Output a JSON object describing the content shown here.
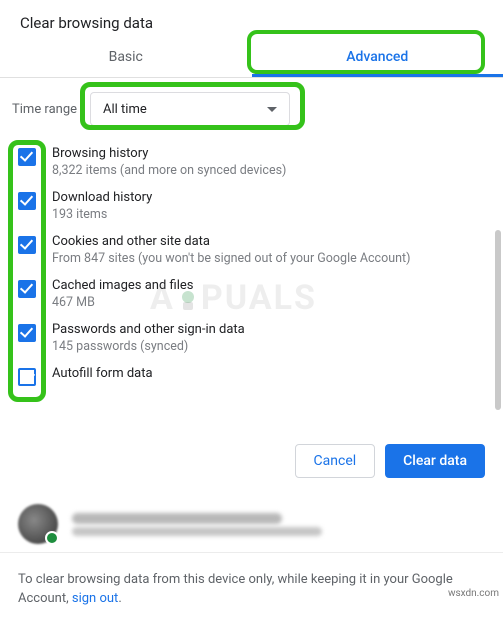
{
  "dialog": {
    "title": "Clear browsing data"
  },
  "tabs": {
    "basic": "Basic",
    "advanced": "Advanced"
  },
  "time": {
    "label": "Time range",
    "value": "All time"
  },
  "items": [
    {
      "title": "Browsing history",
      "sub": "8,322 items (and more on synced devices)"
    },
    {
      "title": "Download history",
      "sub": "193 items"
    },
    {
      "title": "Cookies and other site data",
      "sub": "From 847 sites (you won't be signed out of your Google Account)"
    },
    {
      "title": "Cached images and files",
      "sub": "467 MB"
    },
    {
      "title": "Passwords and other sign-in data",
      "sub": "145 passwords (synced)"
    },
    {
      "title": "Autofill form data",
      "sub": ""
    }
  ],
  "buttons": {
    "cancel": "Cancel",
    "clear": "Clear data"
  },
  "footer": {
    "text_a": "To clear browsing data from this device only, while keeping it in your Google Account, ",
    "signout": "sign out",
    "text_b": "."
  },
  "watermark": {
    "a": "A",
    "b": "PUALS"
  },
  "source": "wsxdn.com"
}
